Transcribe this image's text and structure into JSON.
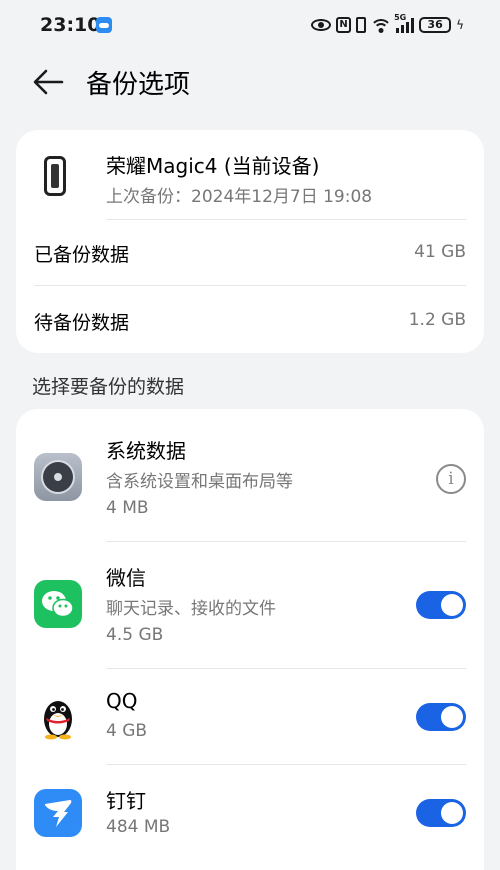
{
  "status_bar": {
    "time": "23:10",
    "nfc": "N",
    "network": "5G",
    "battery": "36",
    "bolt": "ϟ"
  },
  "header": {
    "title": "备份选项"
  },
  "device": {
    "name": "荣耀Magic4 (当前设备)",
    "last_backup": "上次备份：2024年12月7日 19:08"
  },
  "summary": {
    "backed_up_label": "已备份数据",
    "backed_up_value": "41 GB",
    "pending_label": "待备份数据",
    "pending_value": "1.2 GB"
  },
  "section_title": "选择要备份的数据",
  "apps": [
    {
      "name": "系统数据",
      "desc": "含系统设置和桌面布局等",
      "size": "4 MB",
      "control": "info-icon",
      "info_glyph": "i"
    },
    {
      "name": "微信",
      "desc": "聊天记录、接收的文件",
      "size": "4.5 GB",
      "control": "toggle",
      "enabled": true
    },
    {
      "name": "QQ",
      "size": "4 GB",
      "control": "toggle",
      "enabled": true
    },
    {
      "name": "钉钉",
      "size": "484 MB",
      "control": "toggle",
      "enabled": true
    }
  ],
  "colors": {
    "accent": "#1b63e5",
    "background": "#f1f3f5",
    "wechat": "#1ec15f",
    "dingtalk": "#2f8cf7"
  }
}
